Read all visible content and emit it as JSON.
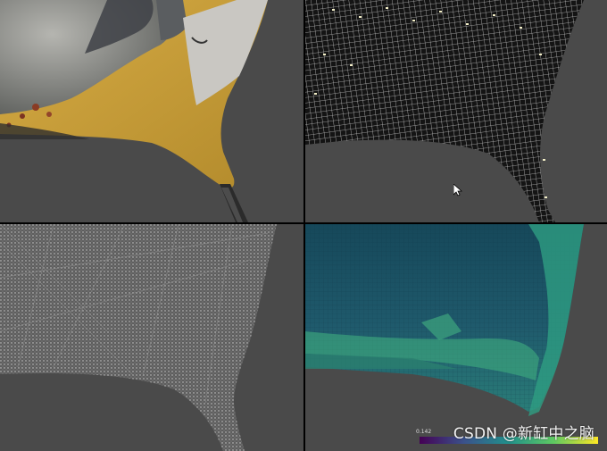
{
  "viewports": [
    {
      "id": "textured-mesh",
      "label": ""
    },
    {
      "id": "wireframe-mesh",
      "label": ""
    },
    {
      "id": "point-cloud",
      "label": ""
    },
    {
      "id": "voxel-colormap",
      "label": ""
    }
  ],
  "colorbar": {
    "min_label": "0.142",
    "colors": [
      "#440154",
      "#3b528b",
      "#21918c",
      "#5ec962",
      "#fde725"
    ]
  },
  "watermark": {
    "text": "CSDN @新缸中之脑"
  },
  "colors": {
    "background": "#4a4a4a",
    "separator": "#000000",
    "mesh_yellow": "#c9a03a"
  }
}
